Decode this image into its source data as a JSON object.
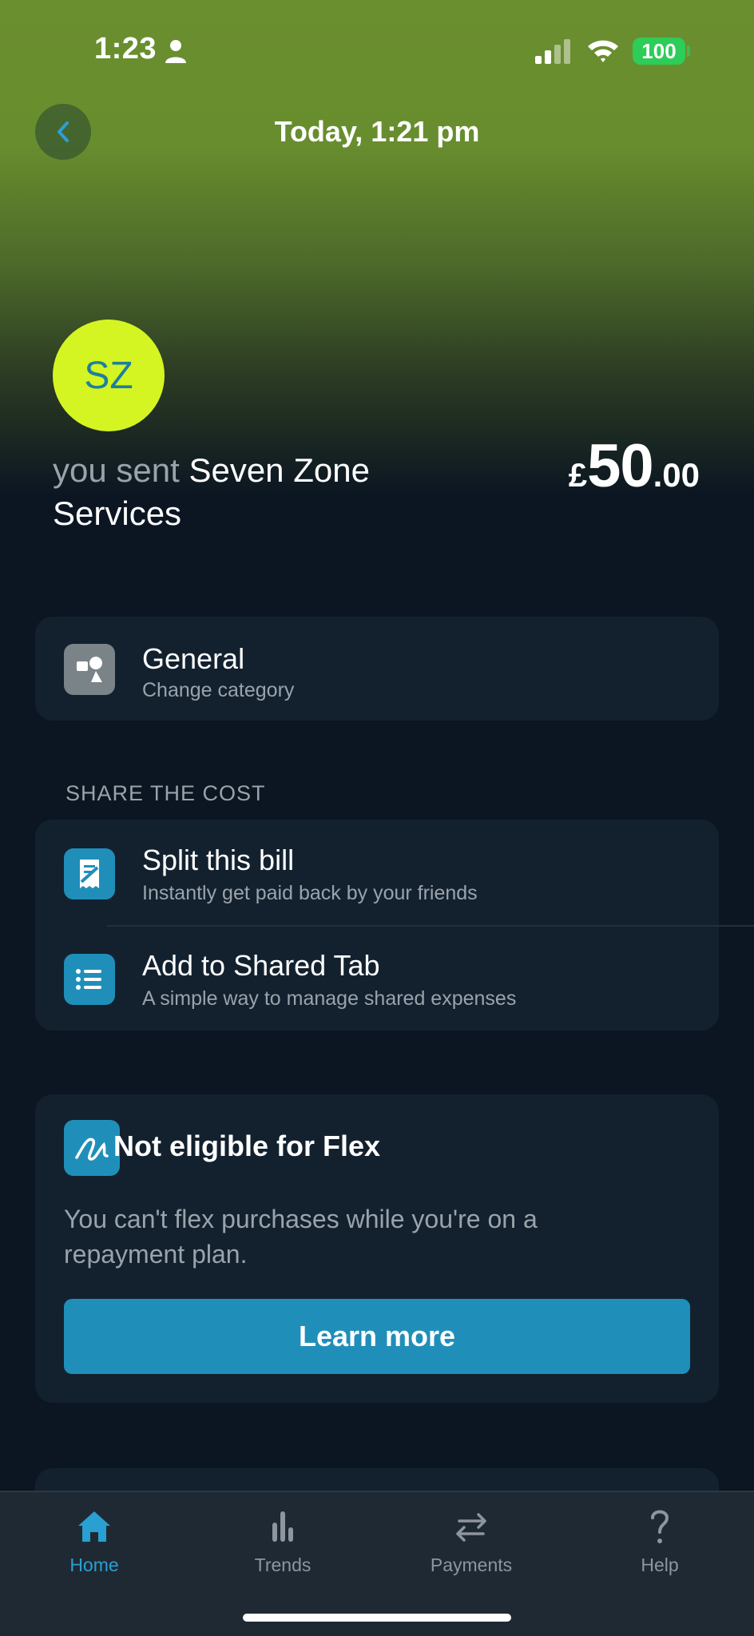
{
  "status_bar": {
    "time": "1:23",
    "battery": "100"
  },
  "header": {
    "title": "Today, 1:21 pm"
  },
  "merchant": {
    "initials": "SZ",
    "prefix": "you sent",
    "name": "Seven Zone Services",
    "amount_currency": "£",
    "amount_major": "50",
    "amount_minor": ".00"
  },
  "category": {
    "title": "General",
    "subtitle": "Change category"
  },
  "share_section": {
    "label": "SHARE THE COST",
    "items": [
      {
        "title": "Split this bill",
        "subtitle": "Instantly get paid back by your friends"
      },
      {
        "title": "Add to Shared Tab",
        "subtitle": "A simple way to manage shared expenses"
      }
    ]
  },
  "flex": {
    "title": "Not eligible for Flex",
    "text": "You can't flex purchases while you're on a repayment plan.",
    "button": "Learn more"
  },
  "tab_bar": {
    "tabs": [
      {
        "label": "Home",
        "active": true
      },
      {
        "label": "Trends",
        "active": false
      },
      {
        "label": "Payments",
        "active": false
      },
      {
        "label": "Help",
        "active": false
      }
    ]
  },
  "colors": {
    "accent": "#1f8fba",
    "avatar_bg": "#d4f522",
    "active_tab": "#2a9fd1"
  }
}
